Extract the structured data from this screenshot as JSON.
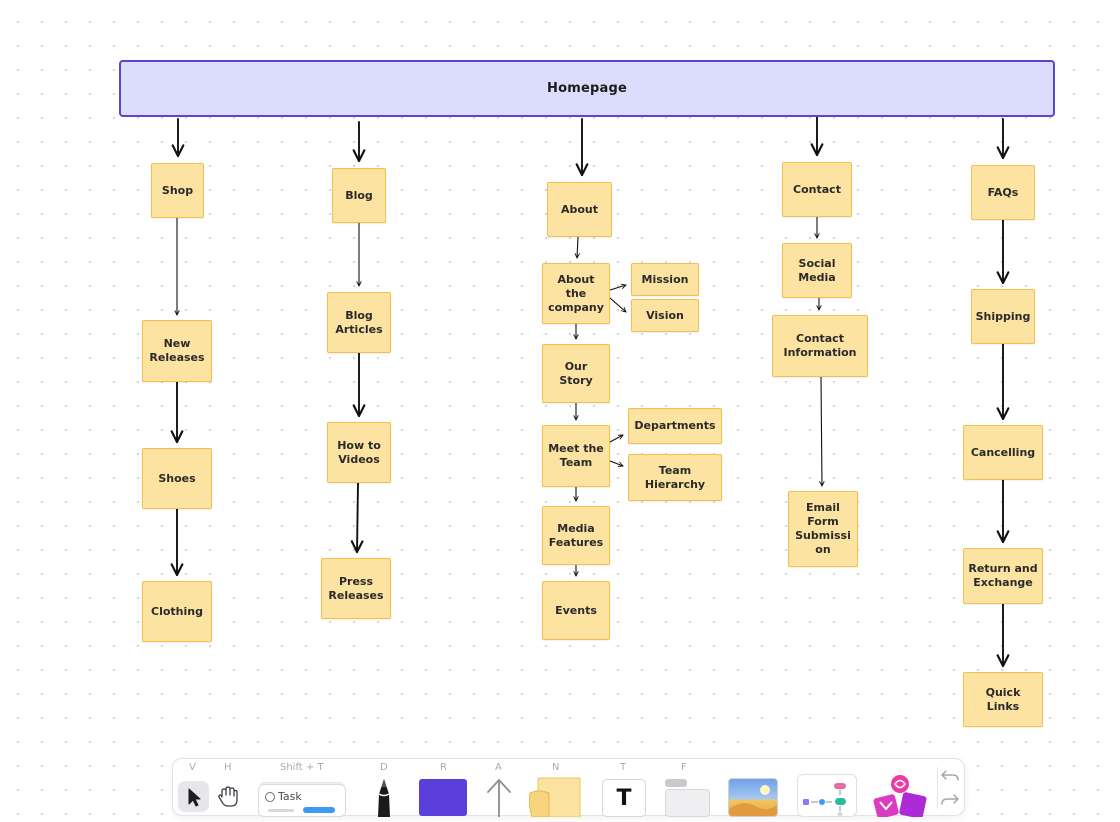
{
  "board": {
    "header": {
      "label": "Homepage"
    },
    "columns": [
      {
        "id": "shop",
        "items": [
          "Shop",
          "New Releases",
          "Shoes",
          "Clothing"
        ]
      },
      {
        "id": "blog",
        "items": [
          "Blog",
          "Blog Articles",
          "How to Videos",
          "Press Releases"
        ]
      },
      {
        "id": "about",
        "items": [
          "About",
          "About the company",
          "Our Story",
          "Meet the Team",
          "Media Features",
          "Events"
        ],
        "branches": {
          "about_company": [
            "Mission",
            "Vision"
          ],
          "meet_team": [
            "Departments",
            "Team Hierarchy"
          ]
        }
      },
      {
        "id": "contact",
        "items": [
          "Contact",
          "Social Media",
          "Contact Information",
          "Email Form Submission"
        ]
      },
      {
        "id": "faqs",
        "items": [
          "FAQs",
          "Shipping",
          "Cancelling",
          "Return and Exchange",
          "Quick Links"
        ]
      }
    ],
    "note_text": {
      "n_shop": "Shop",
      "n_new_releases": "New Releases",
      "n_shoes": "Shoes",
      "n_clothing": "Clothing",
      "n_blog": "Blog",
      "n_blog_articles": "Blog Articles",
      "n_how_to_videos": "How to Videos",
      "n_press_releases": "Press Releases",
      "n_about": "About",
      "n_about_company": "About the company",
      "n_mission": "Mission",
      "n_vision": "Vision",
      "n_our_story": "Our Story",
      "n_meet_team": "Meet the Team",
      "n_departments": "Departments",
      "n_team_hierarchy": "Team Hierarchy",
      "n_media_features": "Media Features",
      "n_events": "Events",
      "n_contact": "Contact",
      "n_social_media": "Social Media",
      "n_contact_information": "Contact Information",
      "n_email_form": "Email Form Submissi on",
      "n_faqs": "FAQs",
      "n_shipping": "Shipping",
      "n_cancelling": "Cancelling",
      "n_return_exchange": "Return and Exchange",
      "n_quick_links": "Quick Links"
    },
    "colors": {
      "header_fill": "#dcdcfc",
      "header_border": "#5b45c9",
      "note_fill": "#fde3a2",
      "note_border": "#f1c14d",
      "arrow": "#111111"
    }
  },
  "toolbar": {
    "tools": [
      {
        "key": "V",
        "name": "select",
        "icon": "cursor-icon",
        "active": true
      },
      {
        "key": "H",
        "name": "hand",
        "icon": "hand-icon"
      },
      {
        "key": "Shift + T",
        "name": "task",
        "label": "Task",
        "icon": "task-card-icon"
      },
      {
        "key": "D",
        "name": "draw",
        "icon": "pen-icon"
      },
      {
        "key": "R",
        "name": "rectangle",
        "icon": "color-swatch-icon",
        "color": "#5b3fdc"
      },
      {
        "key": "A",
        "name": "arrow",
        "icon": "arrow-up-icon"
      },
      {
        "key": "N",
        "name": "sticky-note",
        "icon": "sticky-note-icon"
      },
      {
        "key": "T",
        "name": "text",
        "label": "T",
        "icon": "text-icon"
      },
      {
        "key": "F",
        "name": "frame",
        "icon": "frame-icon"
      },
      {
        "name": "image",
        "icon": "image-icon"
      },
      {
        "name": "diagram",
        "icon": "diagram-icon"
      },
      {
        "name": "integrations",
        "icon": "integrations-icon"
      },
      {
        "name": "undo",
        "icon": "undo-icon"
      },
      {
        "name": "redo",
        "icon": "redo-icon"
      }
    ],
    "keys": {
      "v": "V",
      "h": "H",
      "shift_t": "Shift + T",
      "d": "D",
      "r": "R",
      "a": "A",
      "n": "N",
      "t": "T",
      "f": "F"
    },
    "task_label": "Task",
    "text_label": "T"
  }
}
